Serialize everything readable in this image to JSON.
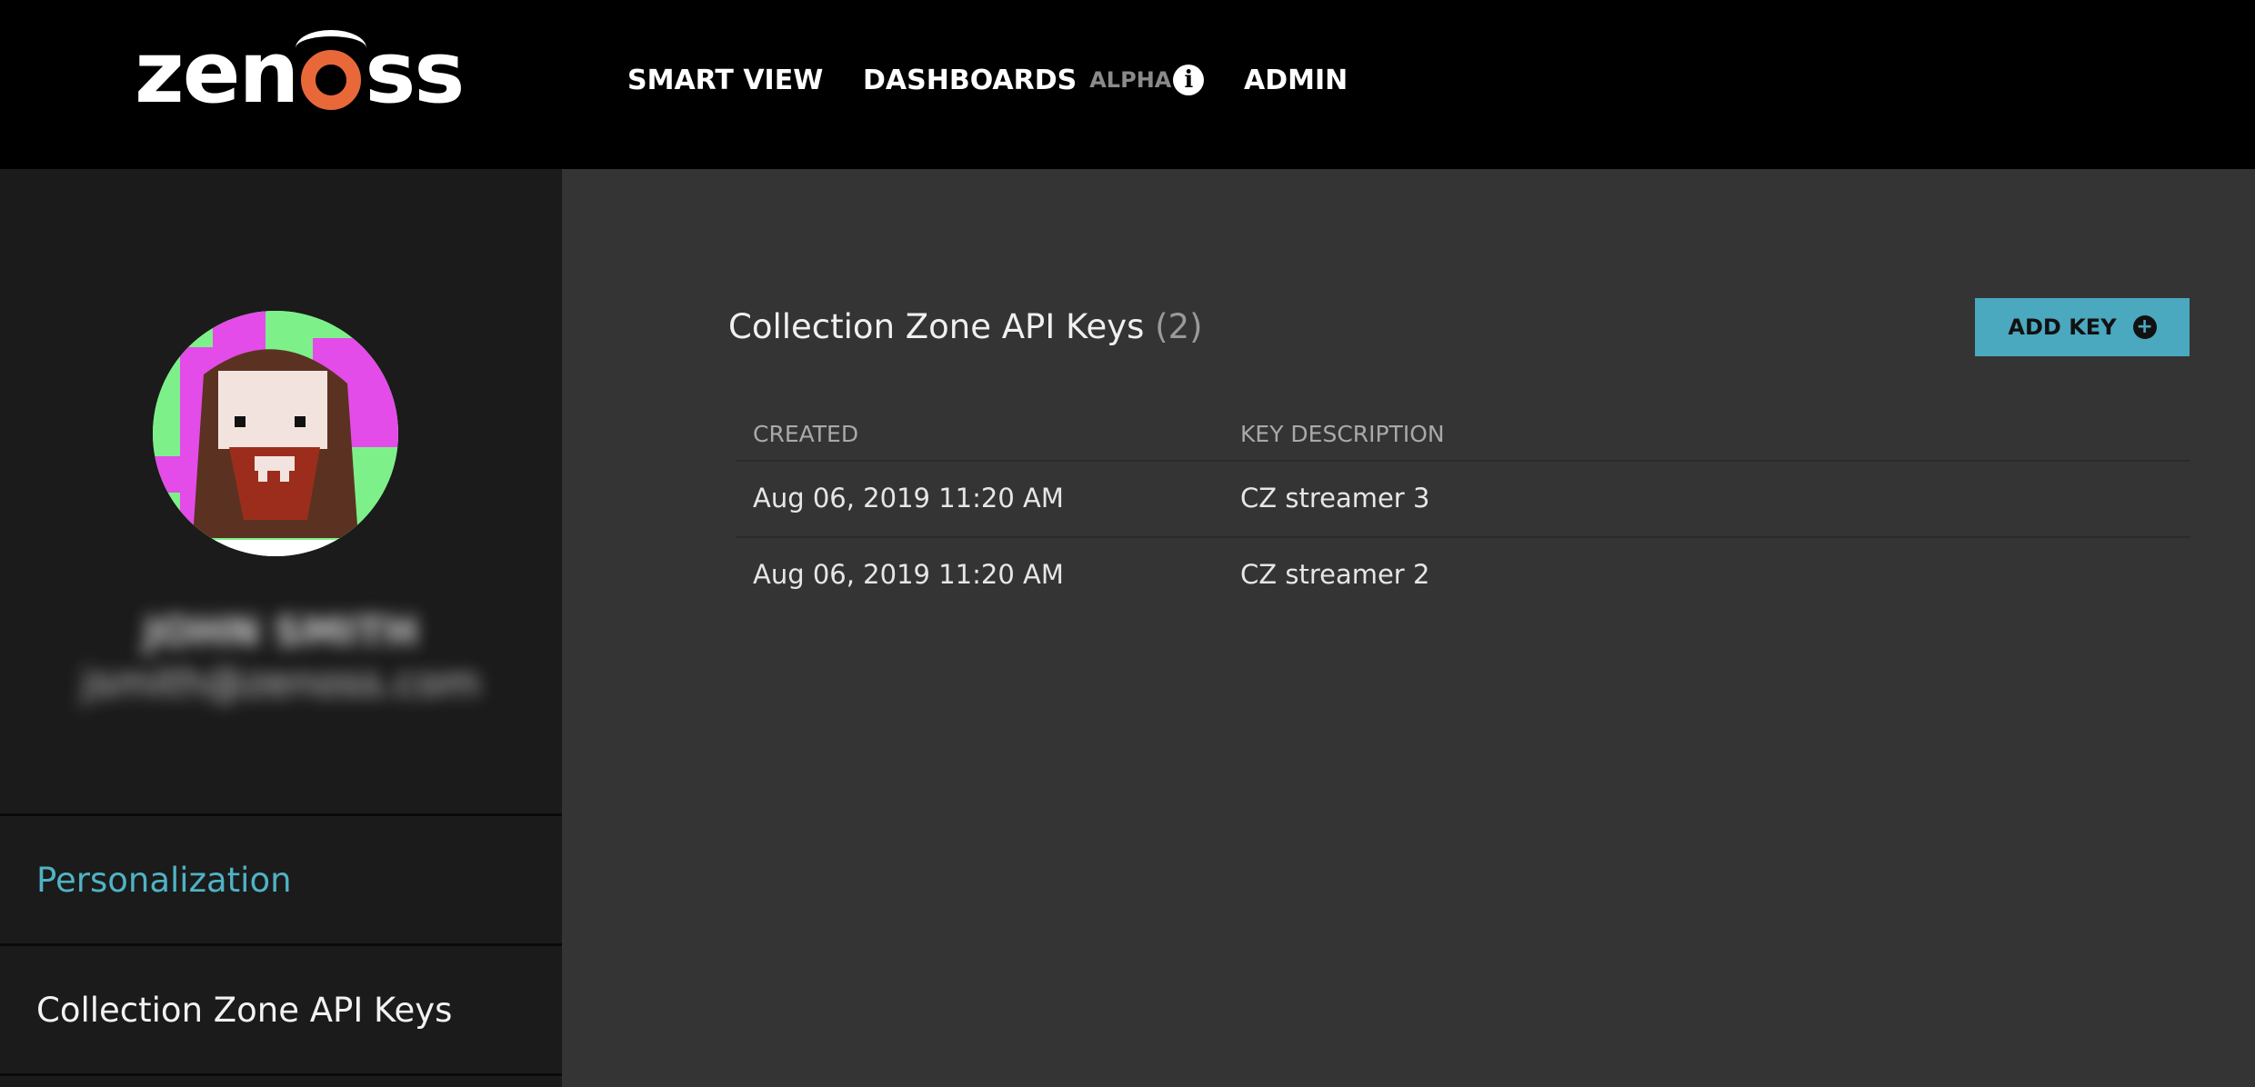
{
  "app": {
    "logo_text_left": "zen",
    "logo_text_right": "ss",
    "brand_color": "#e8683a",
    "accent_color": "#4aa8bf"
  },
  "nav": {
    "smart_view": "SMART VIEW",
    "dashboards": "DASHBOARDS",
    "alpha_badge": "ALPHA",
    "info_icon": "info-icon",
    "admin": "ADMIN"
  },
  "user": {
    "name": "JOHN SMITH",
    "email": "jsmith@zenoss.com"
  },
  "sidebar": {
    "items": [
      {
        "label": "Personalization",
        "active": true
      },
      {
        "label": "Collection Zone API Keys",
        "active": false
      }
    ]
  },
  "main": {
    "title": "Collection Zone API Keys",
    "count": "(2)",
    "add_button": "ADD KEY",
    "add_icon": "plus-circle-icon",
    "columns": [
      "CREATED",
      "KEY DESCRIPTION"
    ],
    "rows": [
      {
        "created": "Aug 06, 2019 11:20 AM",
        "description": "CZ streamer 3"
      },
      {
        "created": "Aug 06, 2019 11:20 AM",
        "description": "CZ streamer 2"
      }
    ]
  }
}
